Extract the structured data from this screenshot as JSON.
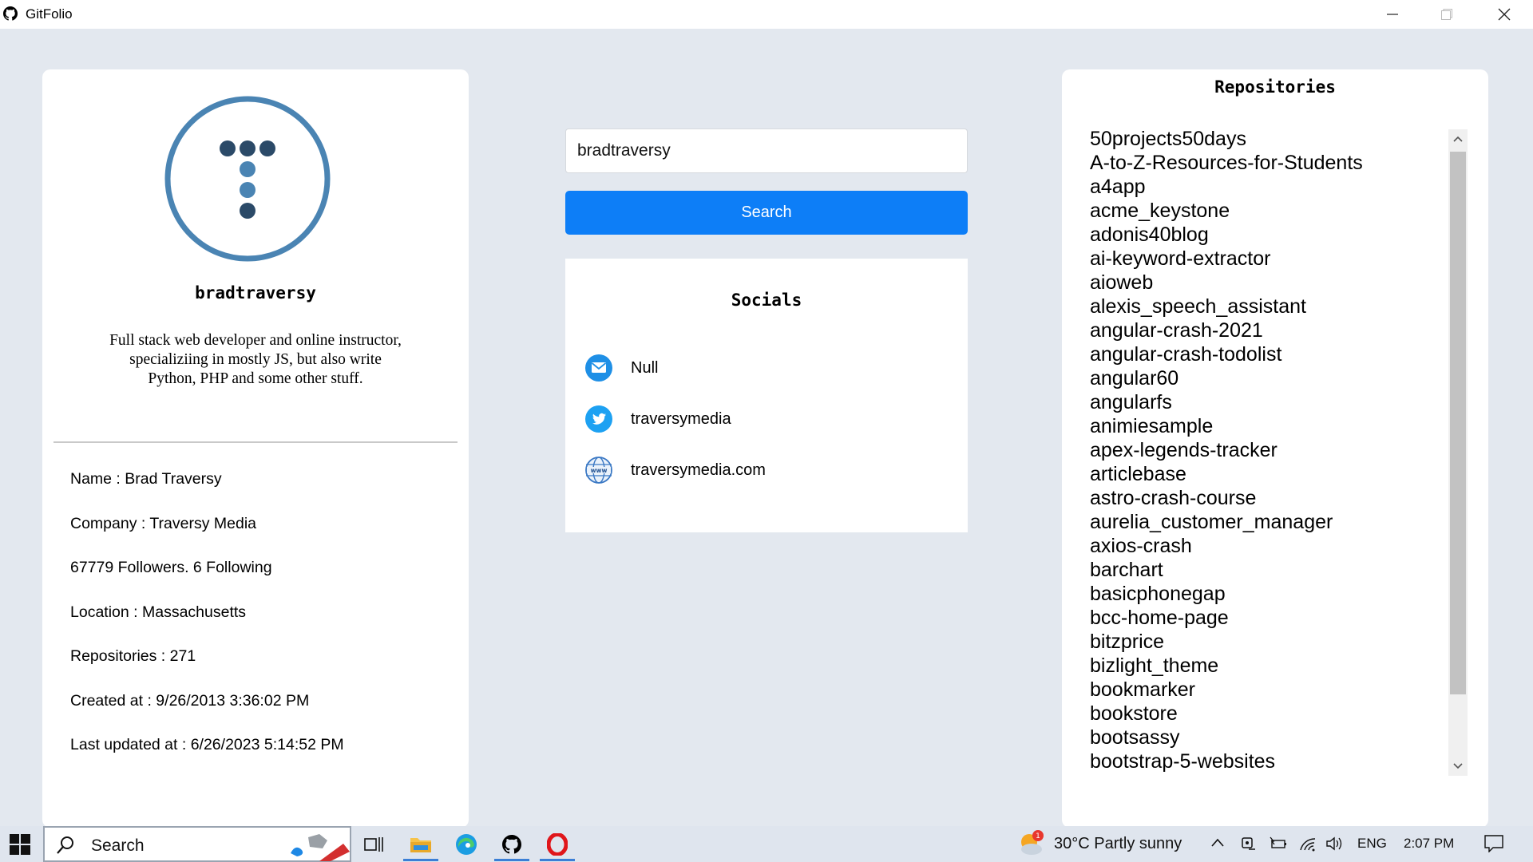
{
  "window": {
    "title": "GitFolio"
  },
  "profile": {
    "username": "bradtraversy",
    "bio": "Full stack web developer and online instructor, specializiing in mostly JS, but also write Python, PHP and some other stuff.",
    "name": "Name : Brad Traversy",
    "company": "Company : Traversy Media",
    "follow": "67779 Followers. 6 Following",
    "location": "Location : Massachusetts",
    "repositories": "Repositories : 271",
    "created": "Created at : 9/26/2013 3:36:02 PM",
    "updated": "Last updated at : 6/26/2023 5:14:52 PM"
  },
  "search": {
    "value": "bradtraversy",
    "button_label": "Search"
  },
  "socials": {
    "title": "Socials",
    "email": "Null",
    "twitter": "traversymedia",
    "website": "traversymedia.com"
  },
  "repos": {
    "title": "Repositories",
    "items": [
      "50projects50days",
      "A-to-Z-Resources-for-Students",
      "a4app",
      "acme_keystone",
      "adonis40blog",
      "ai-keyword-extractor",
      "aioweb",
      "alexis_speech_assistant",
      "angular-crash-2021",
      "angular-crash-todolist",
      "angular60",
      "angularfs",
      "animiesample",
      "apex-legends-tracker",
      "articlebase",
      "astro-crash-course",
      "aurelia_customer_manager",
      "axios-crash",
      "barchart",
      "basicphonegap",
      "bcc-home-page",
      "bitzprice",
      "bizlight_theme",
      "bookmarker",
      "bookstore",
      "bootsassy",
      "bootstrap-5-websites"
    ]
  },
  "taskbar": {
    "search_label": "Search",
    "weather": "30°C  Partly sunny",
    "weather_badge": "1",
    "language": "ENG",
    "time": "2:07 PM"
  }
}
